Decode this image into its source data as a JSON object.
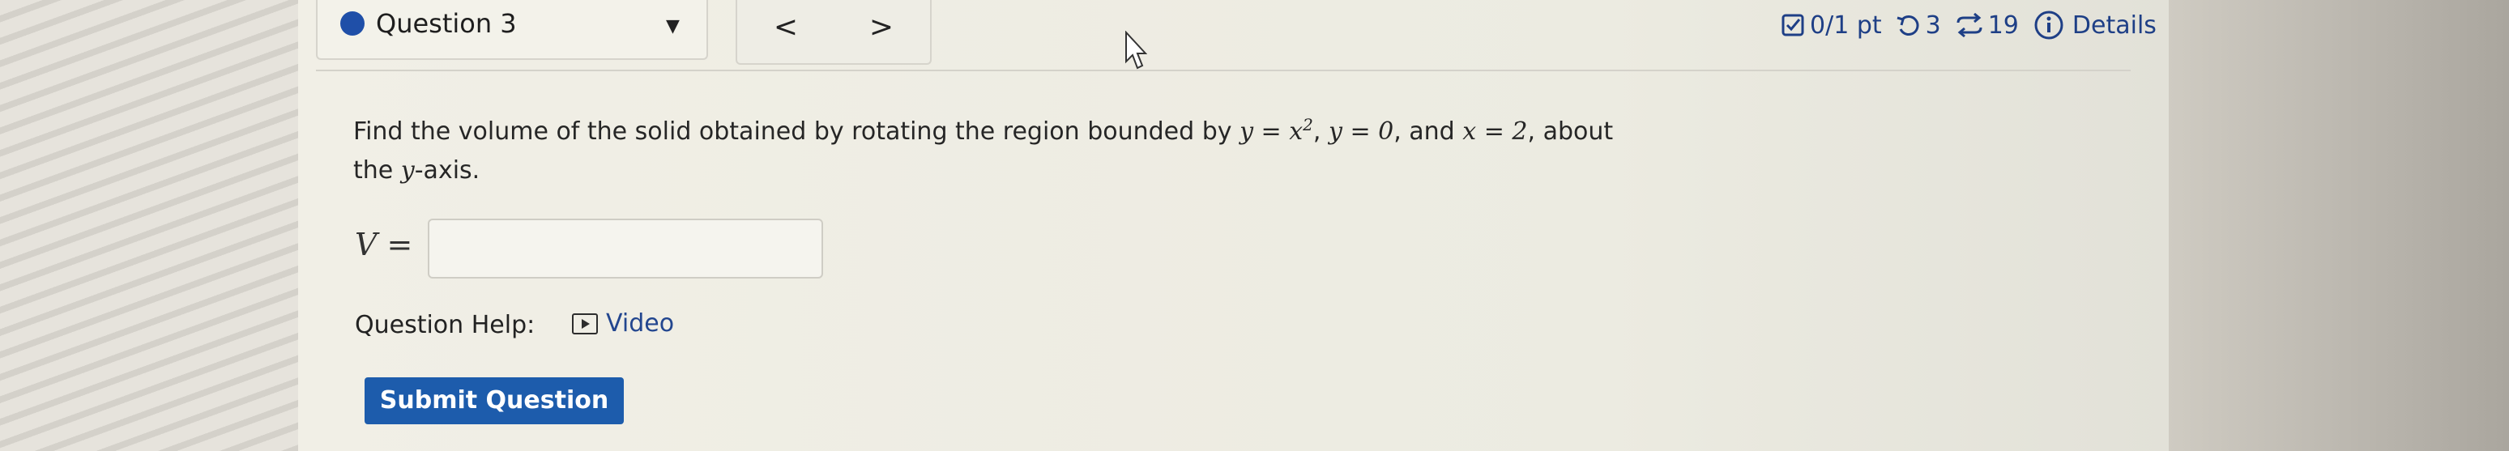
{
  "question": {
    "title": "Question 3",
    "prev_label": "<",
    "next_label": ">"
  },
  "stats": {
    "score": "0/1 pt",
    "retries": "3",
    "attempts": "19",
    "details_label": "Details"
  },
  "prompt": {
    "intro": "Find the volume of the solid obtained by rotating the region bounded by",
    "eq1": "y = x",
    "eq1_exp": "2",
    "eq2": "y = 0",
    "and": "and",
    "eq3": "x = 2",
    "about": "about",
    "the": "the",
    "axis_var": "y",
    "axis_suffix": "-axis."
  },
  "answer": {
    "label": "V =",
    "value": ""
  },
  "help": {
    "label": "Question Help:",
    "video_label": "Video"
  },
  "submit_label": "Submit Question",
  "colors": {
    "accent": "#1d5cac",
    "link": "#23468f",
    "dot": "#1f4fa8"
  }
}
